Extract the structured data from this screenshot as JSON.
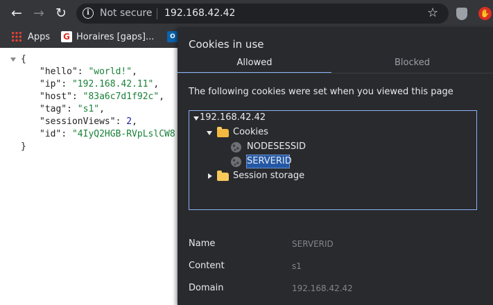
{
  "browser": {
    "security_label": "Not secure",
    "url": "192.168.42.42",
    "info_glyph": "i",
    "back_glyph": "←",
    "forward_glyph": "→",
    "reload_glyph": "↻",
    "star_glyph": "☆"
  },
  "bookmarks": {
    "items": [
      {
        "label": "Apps",
        "icon": "apps-grid-icon"
      },
      {
        "label": "Horaires [gaps]...",
        "icon_letter": "G"
      },
      {
        "label": "",
        "icon_letter": "O",
        "icon": "outlook-icon"
      }
    ]
  },
  "json_view": {
    "open_brace": "{",
    "close_brace": "}",
    "lines": [
      {
        "key": "\"hello\"",
        "value": "\"world!\"",
        "type": "string",
        "trail": ","
      },
      {
        "key": "\"ip\"",
        "value": "\"192.168.42.11\"",
        "type": "string",
        "trail": ","
      },
      {
        "key": "\"host\"",
        "value": "\"83a6c7d1f92c\"",
        "type": "string",
        "trail": ","
      },
      {
        "key": "\"tag\"",
        "value": "\"s1\"",
        "type": "string",
        "trail": ","
      },
      {
        "key": "\"sessionViews\"",
        "value": "2",
        "type": "number",
        "trail": ","
      },
      {
        "key": "\"id\"",
        "value": "\"4IyQ2HGB-RVpLslCW8",
        "type": "string",
        "trail": ""
      }
    ]
  },
  "dialog": {
    "title": "Cookies in use",
    "tabs": [
      "Allowed",
      "Blocked"
    ],
    "description": "The following cookies were set when you viewed this page",
    "tree": {
      "root": "192.168.42.42",
      "cookies_folder": "Cookies",
      "cookies": [
        "NODESESSID",
        "SERVERID"
      ],
      "selected": "SERVERID",
      "storage_folder": "Session storage"
    },
    "details": [
      {
        "label": "Name",
        "value": "SERVERID"
      },
      {
        "label": "Content",
        "value": "s1"
      },
      {
        "label": "Domain",
        "value": "192.168.42.42"
      }
    ]
  },
  "colors": {
    "accent": "#8ab4f8",
    "selection": "#2458a5",
    "json_string": "#188038",
    "json_number": "#1a1aa6"
  }
}
